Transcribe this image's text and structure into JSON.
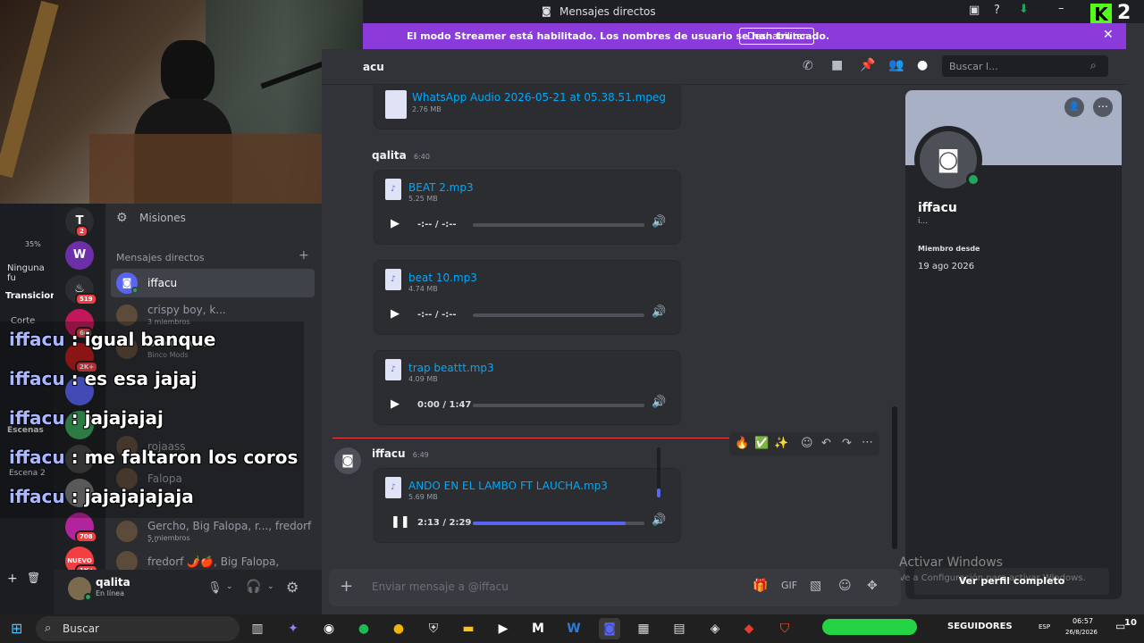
{
  "window": {
    "title": "Mensajes directos"
  },
  "banner": {
    "text": "El modo Streamer está habilitado. Los nombres de usuario se han truncado.",
    "button": "Deshabilitar"
  },
  "header": {
    "channel": "acu",
    "search_placeholder": "Buscar l..."
  },
  "obs": {
    "zoom": "35%",
    "ninguna": "Ninguna fu",
    "transiciones": "Transicion",
    "corte": "Corte",
    "escenas": "Escenas",
    "escena2": "Escena 2"
  },
  "sidebar": {
    "misiones": "Misiones",
    "dm_header": "Mensajes directos",
    "items": [
      {
        "name": "iffacu",
        "sub": ""
      },
      {
        "name": "crispy boy, k...",
        "sub": "3 miembros"
      },
      {
        "name": "Binco Mods",
        "sub": "Binco Mods"
      },
      {
        "name": "rojaass",
        "sub": ""
      },
      {
        "name": "Falopa",
        "sub": ""
      },
      {
        "name": "Gercho, Big Falopa, r..., fredorf ...",
        "sub": "5 miembros"
      },
      {
        "name": "fredorf 🌶️🍎, Big Falopa, crisp...",
        "sub": ""
      }
    ],
    "user": {
      "name": "qalita",
      "status": "En línea"
    }
  },
  "servers": [
    {
      "label": "T",
      "badge": "2",
      "color": "#2b2d31"
    },
    {
      "label": "W",
      "badge": "",
      "color": "#6d2fa7"
    },
    {
      "label": "♨",
      "badge": "519",
      "color": "#2b2d31"
    },
    {
      "label": "",
      "badge": "66",
      "color": "#c2185b"
    },
    {
      "label": "",
      "badge": "2K+",
      "color": "#b71c1c"
    },
    {
      "label": "",
      "badge": "",
      "color": "#5865f2"
    },
    {
      "label": "",
      "badge": "",
      "color": "#3ba55d"
    },
    {
      "label": "",
      "badge": "",
      "color": "#444"
    },
    {
      "label": "",
      "badge": "",
      "color": "#777"
    },
    {
      "label": "",
      "badge": "708",
      "color": "#b3239b"
    },
    {
      "label": "NUEVO",
      "badge": "1K+",
      "color": "#f23f43"
    }
  ],
  "overlay": [
    {
      "name": "iffacu",
      "text": ": igual banque"
    },
    {
      "name": "iffacu",
      "text": ": es esa jajaj"
    },
    {
      "name": "iffacu",
      "text": ": jajajajaj"
    },
    {
      "name": "iffacu",
      "text": ": me faltaron los coros"
    },
    {
      "name": "iffacu",
      "text": ": jajajajajaja"
    }
  ],
  "messages": {
    "top_file": {
      "name": "WhatsApp Audio 2026-05-21 at 05.38.51.mpeg",
      "size": "2.76 MB"
    },
    "qalita": {
      "author": "qalita",
      "time": "6:40"
    },
    "files": [
      {
        "name": "BEAT 2.mp3",
        "size": "5.25 MB",
        "time": "-:-- / -:--",
        "progress": 0
      },
      {
        "name": "beat 10.mp3",
        "size": "4.74 MB",
        "time": "-:-- / -:--",
        "progress": 0
      },
      {
        "name": "trap beattt.mp3",
        "size": "4.09 MB",
        "time": "0:00 / 1:47",
        "progress": 0
      }
    ],
    "iffacu": {
      "author": "iffacu",
      "time": "6:49"
    },
    "last_file": {
      "name": "ANDO EN EL LAMBO FT LAUCHA.mp3",
      "size": "5.69 MB",
      "time": "2:13 / 2:29",
      "progress": 0.89
    }
  },
  "profile": {
    "name": "iffacu",
    "sub": "i...",
    "member_label": "Miembro desde",
    "member_date": "19 ago 2026",
    "full_profile": "Ver perfil completo"
  },
  "watermark": {
    "line1": "Activar Windows",
    "line2": "Ve a Configuración para activar Windows."
  },
  "composer": {
    "placeholder": "Enviar mensaje a @iffacu"
  },
  "taskbar": {
    "search": "Buscar",
    "followers": "SEGUIDORES",
    "lang": "ESP",
    "time": "06:57",
    "date": "26/8/2026",
    "notif": "10"
  },
  "corner": {
    "count": "2"
  }
}
